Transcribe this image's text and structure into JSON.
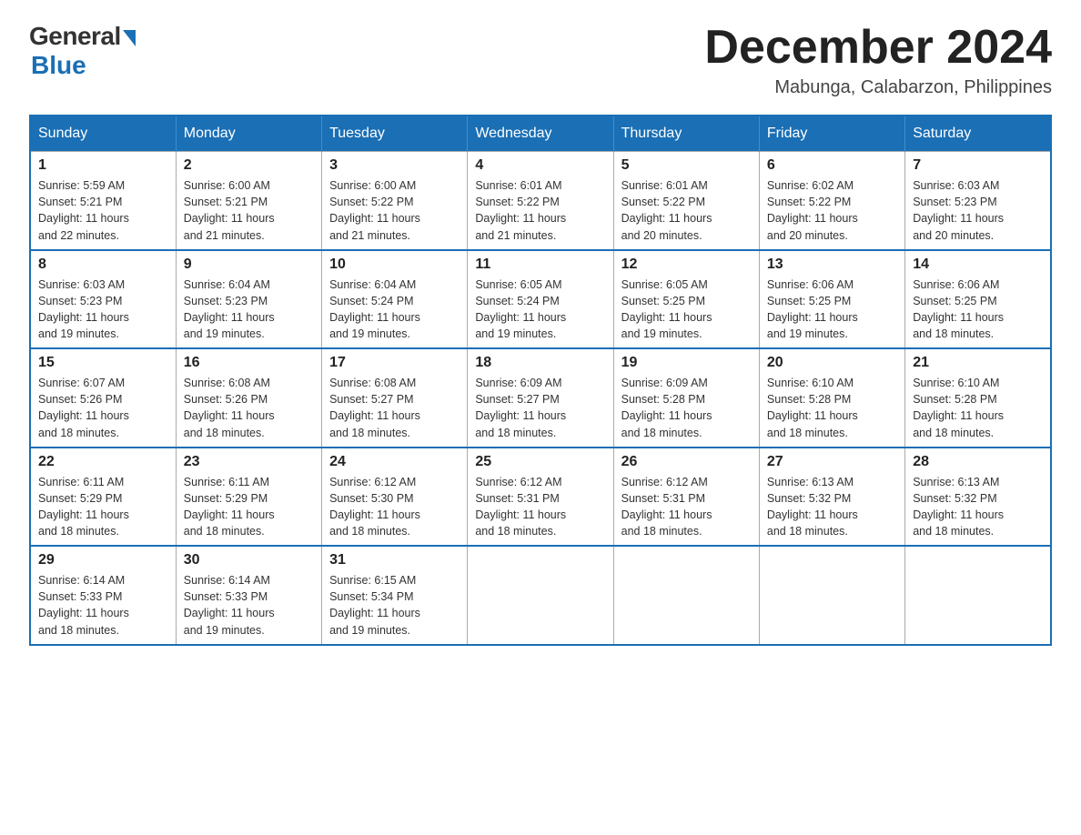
{
  "logo": {
    "general": "General",
    "blue": "Blue"
  },
  "title": "December 2024",
  "subtitle": "Mabunga, Calabarzon, Philippines",
  "headers": [
    "Sunday",
    "Monday",
    "Tuesday",
    "Wednesday",
    "Thursday",
    "Friday",
    "Saturday"
  ],
  "weeks": [
    [
      {
        "day": "1",
        "info": "Sunrise: 5:59 AM\nSunset: 5:21 PM\nDaylight: 11 hours\nand 22 minutes."
      },
      {
        "day": "2",
        "info": "Sunrise: 6:00 AM\nSunset: 5:21 PM\nDaylight: 11 hours\nand 21 minutes."
      },
      {
        "day": "3",
        "info": "Sunrise: 6:00 AM\nSunset: 5:22 PM\nDaylight: 11 hours\nand 21 minutes."
      },
      {
        "day": "4",
        "info": "Sunrise: 6:01 AM\nSunset: 5:22 PM\nDaylight: 11 hours\nand 21 minutes."
      },
      {
        "day": "5",
        "info": "Sunrise: 6:01 AM\nSunset: 5:22 PM\nDaylight: 11 hours\nand 20 minutes."
      },
      {
        "day": "6",
        "info": "Sunrise: 6:02 AM\nSunset: 5:22 PM\nDaylight: 11 hours\nand 20 minutes."
      },
      {
        "day": "7",
        "info": "Sunrise: 6:03 AM\nSunset: 5:23 PM\nDaylight: 11 hours\nand 20 minutes."
      }
    ],
    [
      {
        "day": "8",
        "info": "Sunrise: 6:03 AM\nSunset: 5:23 PM\nDaylight: 11 hours\nand 19 minutes."
      },
      {
        "day": "9",
        "info": "Sunrise: 6:04 AM\nSunset: 5:23 PM\nDaylight: 11 hours\nand 19 minutes."
      },
      {
        "day": "10",
        "info": "Sunrise: 6:04 AM\nSunset: 5:24 PM\nDaylight: 11 hours\nand 19 minutes."
      },
      {
        "day": "11",
        "info": "Sunrise: 6:05 AM\nSunset: 5:24 PM\nDaylight: 11 hours\nand 19 minutes."
      },
      {
        "day": "12",
        "info": "Sunrise: 6:05 AM\nSunset: 5:25 PM\nDaylight: 11 hours\nand 19 minutes."
      },
      {
        "day": "13",
        "info": "Sunrise: 6:06 AM\nSunset: 5:25 PM\nDaylight: 11 hours\nand 19 minutes."
      },
      {
        "day": "14",
        "info": "Sunrise: 6:06 AM\nSunset: 5:25 PM\nDaylight: 11 hours\nand 18 minutes."
      }
    ],
    [
      {
        "day": "15",
        "info": "Sunrise: 6:07 AM\nSunset: 5:26 PM\nDaylight: 11 hours\nand 18 minutes."
      },
      {
        "day": "16",
        "info": "Sunrise: 6:08 AM\nSunset: 5:26 PM\nDaylight: 11 hours\nand 18 minutes."
      },
      {
        "day": "17",
        "info": "Sunrise: 6:08 AM\nSunset: 5:27 PM\nDaylight: 11 hours\nand 18 minutes."
      },
      {
        "day": "18",
        "info": "Sunrise: 6:09 AM\nSunset: 5:27 PM\nDaylight: 11 hours\nand 18 minutes."
      },
      {
        "day": "19",
        "info": "Sunrise: 6:09 AM\nSunset: 5:28 PM\nDaylight: 11 hours\nand 18 minutes."
      },
      {
        "day": "20",
        "info": "Sunrise: 6:10 AM\nSunset: 5:28 PM\nDaylight: 11 hours\nand 18 minutes."
      },
      {
        "day": "21",
        "info": "Sunrise: 6:10 AM\nSunset: 5:28 PM\nDaylight: 11 hours\nand 18 minutes."
      }
    ],
    [
      {
        "day": "22",
        "info": "Sunrise: 6:11 AM\nSunset: 5:29 PM\nDaylight: 11 hours\nand 18 minutes."
      },
      {
        "day": "23",
        "info": "Sunrise: 6:11 AM\nSunset: 5:29 PM\nDaylight: 11 hours\nand 18 minutes."
      },
      {
        "day": "24",
        "info": "Sunrise: 6:12 AM\nSunset: 5:30 PM\nDaylight: 11 hours\nand 18 minutes."
      },
      {
        "day": "25",
        "info": "Sunrise: 6:12 AM\nSunset: 5:31 PM\nDaylight: 11 hours\nand 18 minutes."
      },
      {
        "day": "26",
        "info": "Sunrise: 6:12 AM\nSunset: 5:31 PM\nDaylight: 11 hours\nand 18 minutes."
      },
      {
        "day": "27",
        "info": "Sunrise: 6:13 AM\nSunset: 5:32 PM\nDaylight: 11 hours\nand 18 minutes."
      },
      {
        "day": "28",
        "info": "Sunrise: 6:13 AM\nSunset: 5:32 PM\nDaylight: 11 hours\nand 18 minutes."
      }
    ],
    [
      {
        "day": "29",
        "info": "Sunrise: 6:14 AM\nSunset: 5:33 PM\nDaylight: 11 hours\nand 18 minutes."
      },
      {
        "day": "30",
        "info": "Sunrise: 6:14 AM\nSunset: 5:33 PM\nDaylight: 11 hours\nand 19 minutes."
      },
      {
        "day": "31",
        "info": "Sunrise: 6:15 AM\nSunset: 5:34 PM\nDaylight: 11 hours\nand 19 minutes."
      },
      {
        "day": "",
        "info": ""
      },
      {
        "day": "",
        "info": ""
      },
      {
        "day": "",
        "info": ""
      },
      {
        "day": "",
        "info": ""
      }
    ]
  ]
}
